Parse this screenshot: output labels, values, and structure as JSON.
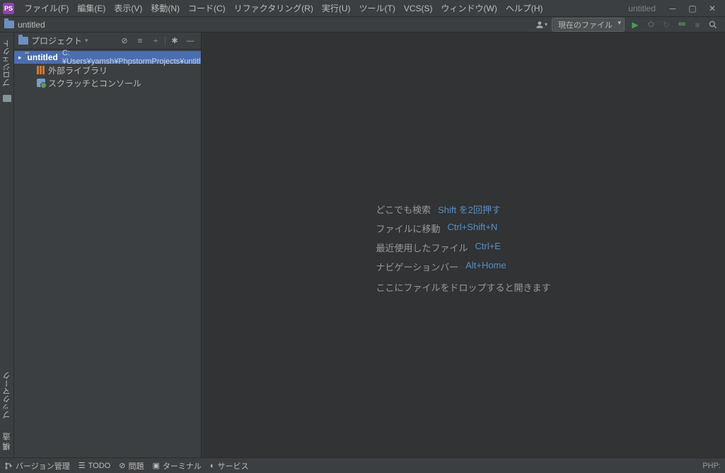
{
  "app": {
    "icon_text": "PS",
    "title": "untitled"
  },
  "menu": {
    "file": "ファイル(F)",
    "edit": "編集(E)",
    "view": "表示(V)",
    "navigate": "移動(N)",
    "code": "コード(C)",
    "refactor": "リファクタリング(R)",
    "run": "実行(U)",
    "tools": "ツール(T)",
    "vcs": "VCS(S)",
    "window": "ウィンドウ(W)",
    "help": "ヘルプ(H)"
  },
  "navbar": {
    "project_name": "untitled"
  },
  "toolbar_right": {
    "run_config": "現在のファイル"
  },
  "left_gutter": {
    "project_tab": "プロジェクト",
    "bookmarks_tab": "ブックマーク",
    "structure_tab": "構\n造"
  },
  "project_panel": {
    "title": "プロジェクト",
    "root": {
      "name": "untitled",
      "path": "C:¥Users¥yamsh¥PhpstormProjects¥untitled"
    },
    "external_libs": "外部ライブラリ",
    "scratches": "スクラッチとコンソール"
  },
  "welcome": {
    "rows": [
      {
        "label": "どこでも検索",
        "shortcut": "Shift を2回押す"
      },
      {
        "label": "ファイルに移動",
        "shortcut": "Ctrl+Shift+N"
      },
      {
        "label": "最近使用したファイル",
        "shortcut": "Ctrl+E"
      },
      {
        "label": "ナビゲーションバー",
        "shortcut": "Alt+Home"
      }
    ],
    "drop": "ここにファイルをドロップすると開きます"
  },
  "statusbar": {
    "vcs": "バージョン管理",
    "todo": "TODO",
    "problems": "問題",
    "terminal": "ターミナル",
    "services": "サービス",
    "lang": "PHP:"
  }
}
